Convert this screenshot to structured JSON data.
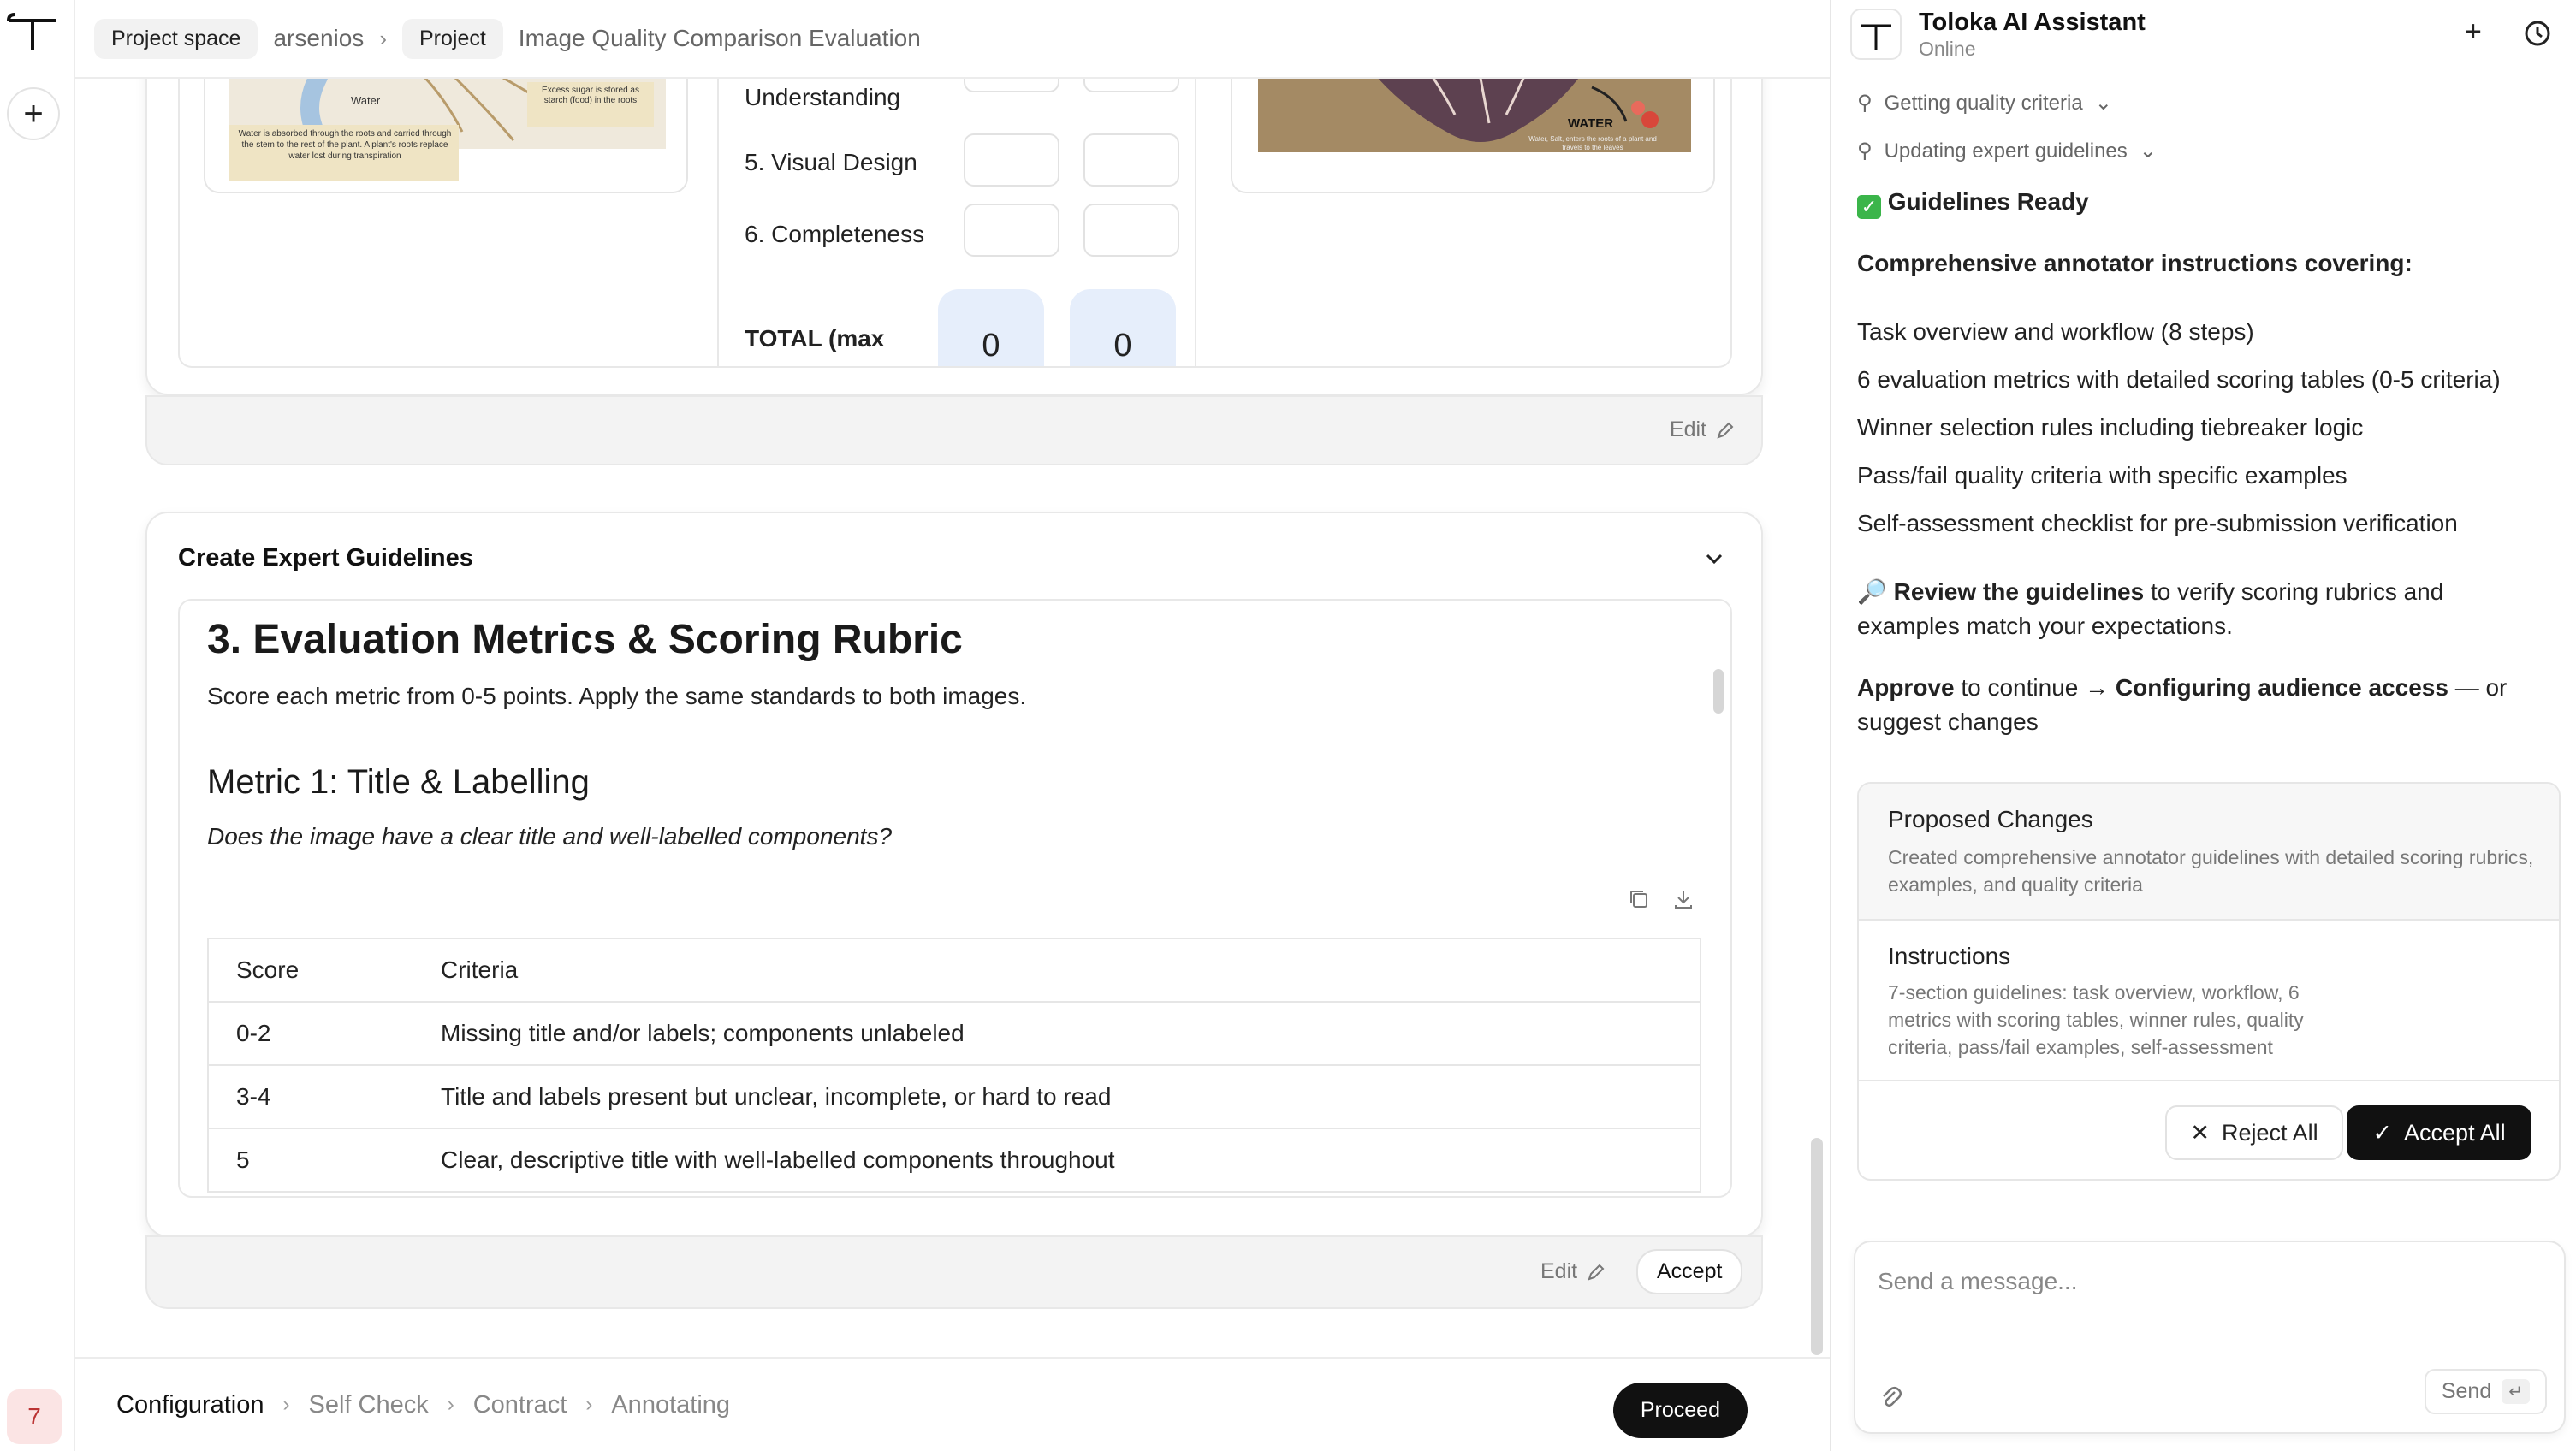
{
  "rail": {
    "badge": "7"
  },
  "breadcrumb": {
    "project_space": "Project space",
    "user": "arsenios",
    "project": "Project",
    "title": "Image Quality Comparison Evaluation"
  },
  "comparison": {
    "left_image_captions": {
      "water": "Water",
      "sugar": "Excess sugar is stored as starch (food) in the roots",
      "absorbed": "Water is absorbed through the roots and carried through the stem to the rest of the plant. A plant's roots replace water lost during transpiration"
    },
    "right_image_captions": {
      "water": "WATER",
      "small": "Water, Salt, enters the roots of a plant and travels to the leaves"
    },
    "metrics": [
      {
        "label": "Understanding"
      },
      {
        "label": "5. Visual Design"
      },
      {
        "label": "6. Completeness"
      }
    ],
    "total_label": "TOTAL (max",
    "total_a": "0",
    "total_b": "0",
    "edit_label": "Edit"
  },
  "guidelines": {
    "section_title": "Create Expert Guidelines",
    "heading": "3. Evaluation Metrics & Scoring Rubric",
    "intro": "Score each metric from 0-5 points. Apply the same standards to both images.",
    "metric_title": "Metric 1: Title & Labelling",
    "metric_question": "Does the image have a clear title and well-labelled components?",
    "table": {
      "headers": [
        "Score",
        "Criteria"
      ],
      "rows": [
        [
          "0-2",
          "Missing title and/or labels; components unlabeled"
        ],
        [
          "3-4",
          "Title and labels present but unclear, incomplete, or hard to read"
        ],
        [
          "5",
          "Clear, descriptive title with well-labelled components throughout"
        ]
      ]
    },
    "edit_label": "Edit",
    "accept_label": "Accept"
  },
  "workflow": {
    "steps": [
      "Configuration",
      "Self Check",
      "Contract",
      "Annotating"
    ],
    "proceed_label": "Proceed"
  },
  "assistant": {
    "title": "Toloka AI Assistant",
    "status": "Online",
    "tool_calls": [
      "Getting quality criteria",
      "Updating expert guidelines"
    ],
    "ready": "Guidelines Ready",
    "instructions_heading": "Comprehensive annotator instructions covering:",
    "bullets": [
      "Task overview and workflow (8 steps)",
      "6 evaluation metrics with detailed scoring tables (0-5 criteria)",
      "Winner selection rules including tiebreaker logic",
      "Pass/fail quality criteria with specific examples",
      "Self-assessment checklist for pre-submission verification"
    ],
    "review_bold": "Review the guidelines",
    "review_rest": " to verify scoring rubrics and examples match your expectations.",
    "approve_bold": "Approve",
    "approve_mid": " to continue → ",
    "approve_target": "Configuring audience access",
    "approve_rest": " — or suggest changes",
    "changes": {
      "title": "Proposed Changes",
      "desc": "Created comprehensive annotator guidelines with detailed scoring rubrics, examples, and quality criteria",
      "section_title": "Instructions",
      "section_desc": "7-section guidelines: task overview, workflow, 6 metrics with scoring tables, winner rules, quality criteria, pass/fail examples, self-assessment",
      "reject_label": "Reject All",
      "accept_label": "Accept All"
    },
    "composer": {
      "placeholder": "Send a message...",
      "send_label": "Send"
    }
  }
}
